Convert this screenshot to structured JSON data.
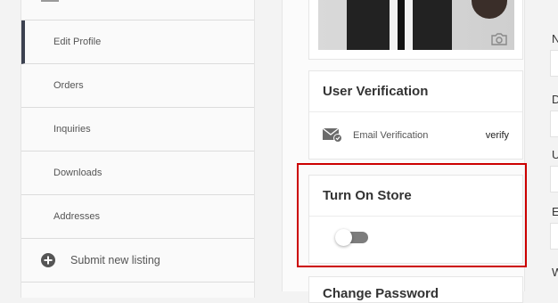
{
  "sidebar": {
    "items": [
      {
        "label": "Edit Profile",
        "active": true
      },
      {
        "label": "Orders"
      },
      {
        "label": "Inquiries"
      },
      {
        "label": "Downloads"
      },
      {
        "label": "Addresses"
      }
    ],
    "submit_label": "Submit new listing"
  },
  "verification": {
    "title": "User Verification",
    "email_label": "Email Verification",
    "verify_link": "verify"
  },
  "store": {
    "title": "Turn On Store",
    "toggle_on": false
  },
  "change_card": {
    "title": "Change Password"
  },
  "right_labels": [
    "N",
    "D",
    "U",
    "E",
    "W"
  ],
  "colors": {
    "highlight": "#cc0000",
    "active_indicator": "#3c4150"
  }
}
